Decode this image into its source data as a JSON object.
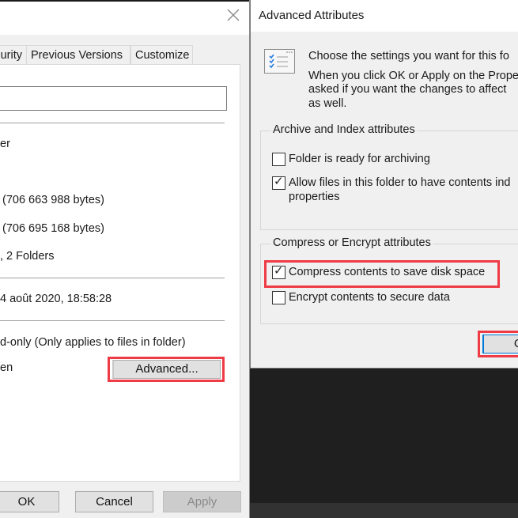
{
  "properties_dialog": {
    "close_icon": "×",
    "tabs": [
      {
        "label": "urity"
      },
      {
        "label": "Previous Versions"
      },
      {
        "label": "Customize"
      }
    ],
    "name_value": "",
    "type_text": "er",
    "size_text": "(706 663 988 bytes)",
    "size_on_disk_text": "(706 695 168 bytes)",
    "contains_text": ", 2 Folders",
    "created_text": "4 août 2020, 18:58:28",
    "readonly_text": "d-only (Only applies to files in folder)",
    "hidden_text": "en",
    "advanced_button": "Advanced...",
    "buttons": {
      "ok": "OK",
      "cancel": "Cancel",
      "apply": "Apply"
    }
  },
  "advanced_attributes": {
    "title": "Advanced Attributes",
    "description_line1": "Choose the settings you want for this fo",
    "description_line2": "When you click OK or Apply on the Prope",
    "description_line3": "asked if you want the changes to affect",
    "description_line4": "as well.",
    "archive_group": {
      "label": "Archive and Index attributes",
      "options": [
        {
          "label": "Folder is ready for archiving",
          "checked": false
        },
        {
          "label": "Allow files in this folder to have contents ind",
          "label2": "properties",
          "checked": true
        }
      ]
    },
    "compress_group": {
      "label": "Compress or Encrypt attributes",
      "options": [
        {
          "label": "Compress contents to save disk space",
          "checked": true
        },
        {
          "label": "Encrypt contents to secure data",
          "checked": false
        }
      ]
    },
    "ok_button": "O",
    "check_glyph": "✓"
  },
  "colors": {
    "highlight_red": "#ef3b45",
    "focus_blue": "#0078d7"
  }
}
